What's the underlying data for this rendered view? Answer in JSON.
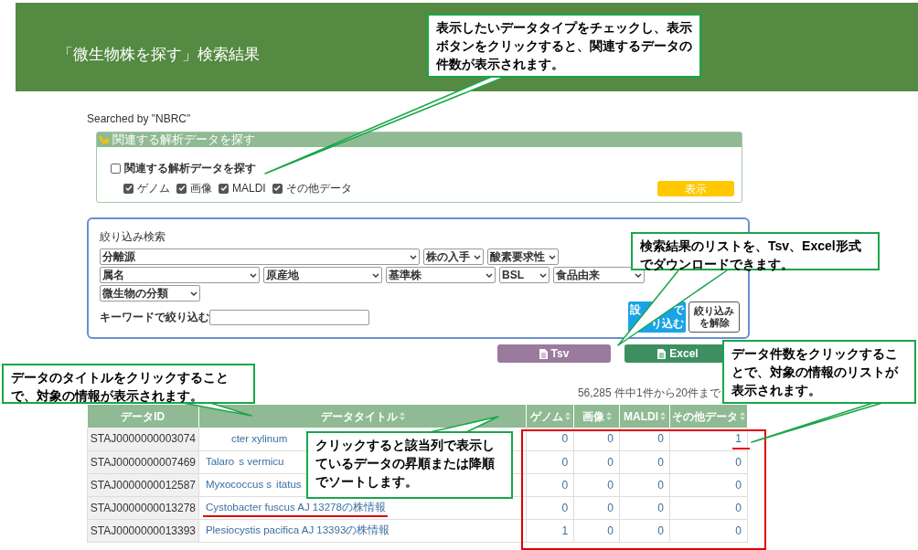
{
  "header": {
    "title": "「微生物株を探す」検索結果"
  },
  "searched_by": "Searched by \"NBRC\"",
  "related_panel": {
    "title": "関連する解析データを探す",
    "main_checkbox": {
      "label": "関連する解析データを探す",
      "checked": false
    },
    "types": [
      {
        "label": "ゲノム",
        "checked": true
      },
      {
        "label": "画像",
        "checked": true
      },
      {
        "label": "MALDI",
        "checked": true
      },
      {
        "label": "その他データ",
        "checked": true
      }
    ],
    "show_button": "表示"
  },
  "filter": {
    "title": "絞り込み検索",
    "select_rows": [
      [
        "分離源",
        "株の入手",
        "酸素要求性"
      ],
      [
        "属名",
        "原産地",
        "基準株",
        "BSL",
        "食品由来"
      ],
      [
        "微生物の分類"
      ]
    ],
    "keyword_label": "キーワードで絞り込む",
    "apply_button": [
      "設",
      "で",
      "り込む"
    ],
    "clear_button": [
      "絞り込み",
      "を解除"
    ]
  },
  "downloads": [
    {
      "label": "Tsv",
      "kind": "tsv"
    },
    {
      "label": "Excel",
      "kind": "excel"
    }
  ],
  "result_count": "56,285 件中1件から20件まで",
  "table": {
    "columns": [
      {
        "label": "データID",
        "sortable": false
      },
      {
        "label": "データタイトル",
        "sortable": true
      },
      {
        "label": "ゲノム",
        "sortable": true
      },
      {
        "label": "画像",
        "sortable": true
      },
      {
        "label": "MALDI",
        "sortable": true
      },
      {
        "label": "その他データ",
        "sortable": true
      }
    ],
    "rows": [
      {
        "id": "STAJ0000000003074",
        "title_parts": [
          "cter xylinum"
        ],
        "counts": [
          "0",
          "0",
          "0",
          "1"
        ]
      },
      {
        "id": "STAJ0000000007469",
        "title_parts": [
          "Talaro",
          "s vermicu"
        ],
        "counts": [
          "0",
          "0",
          "0",
          "0"
        ]
      },
      {
        "id": "STAJ0000000012587",
        "title_parts": [
          "Myxococcus s",
          "itatus"
        ],
        "counts": [
          "0",
          "0",
          "0",
          "0"
        ]
      },
      {
        "id": "STAJ0000000013278",
        "title_parts": [
          "Cystobacter fuscus AJ 13278の株情報"
        ],
        "counts": [
          "0",
          "0",
          "0",
          "0"
        ]
      },
      {
        "id": "STAJ0000000013393",
        "title_parts": [
          "Plesiocystis pacifica AJ 13393の株情報"
        ],
        "counts": [
          "1",
          "0",
          "0",
          "0"
        ]
      }
    ]
  },
  "callouts": [
    "表示したいデータタイプをチェックし、表示ボタンをクリックすると、関連するデータの件数が表示されます。",
    "検索結果のリストを、Tsv、Excel形式でダウンロードできます。",
    "データのタイトルをクリックすることで、対象の情報が表示されます。",
    "データ件数をクリックすることで、対象の情報のリストが表示されます。",
    "クリックすると該当列で表示しているデータの昇順または降順でソートします。"
  ]
}
